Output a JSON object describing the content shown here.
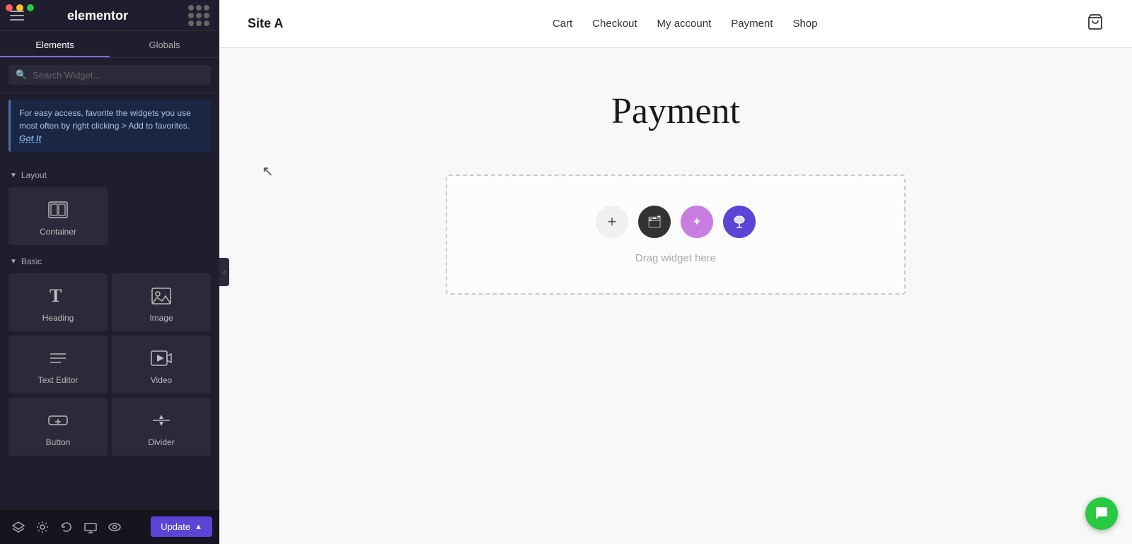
{
  "sidebar": {
    "logo_text": "elementor",
    "tabs": [
      {
        "id": "elements",
        "label": "Elements",
        "active": true
      },
      {
        "id": "globals",
        "label": "Globals",
        "active": false
      }
    ],
    "search_placeholder": "Search Widget...",
    "tip_banner": {
      "text": "For easy access, favorite the widgets you use most often by right clicking > Add to favorites.",
      "cta": "Got It"
    },
    "sections": [
      {
        "id": "layout",
        "label": "Layout",
        "widgets": [
          {
            "id": "container",
            "label": "Container",
            "icon": "container-icon"
          }
        ]
      },
      {
        "id": "basic",
        "label": "Basic",
        "widgets": [
          {
            "id": "heading",
            "label": "Heading",
            "icon": "heading-icon"
          },
          {
            "id": "image",
            "label": "Image",
            "icon": "image-icon"
          },
          {
            "id": "text-editor",
            "label": "Text Editor",
            "icon": "text-editor-icon"
          },
          {
            "id": "video",
            "label": "Video",
            "icon": "video-icon"
          },
          {
            "id": "button",
            "label": "Button",
            "icon": "button-icon"
          },
          {
            "id": "divider",
            "label": "Divider",
            "icon": "divider-icon"
          }
        ]
      }
    ],
    "footer": {
      "update_label": "Update",
      "icons": [
        "layers-icon",
        "settings-icon",
        "history-icon",
        "responsive-icon",
        "visibility-icon",
        "chat-icon"
      ]
    }
  },
  "preview": {
    "nav": {
      "brand": "Site A",
      "links": [
        "Cart",
        "Checkout",
        "My account",
        "Payment",
        "Shop"
      ]
    },
    "page_title": "Payment",
    "drop_zone_label": "Drag widget here",
    "drop_zone_icons": [
      {
        "id": "add",
        "symbol": "+"
      },
      {
        "id": "folder",
        "symbol": "🗂"
      },
      {
        "id": "sparkle",
        "symbol": "✦"
      },
      {
        "id": "ai",
        "symbol": "☁"
      }
    ]
  },
  "colors": {
    "accent_purple": "#5a45d6",
    "accent_light_purple": "#c87ee0",
    "accent_green": "#28ca41",
    "sidebar_bg": "#1e1e2e",
    "sidebar_widget_bg": "#2a2a3a"
  }
}
